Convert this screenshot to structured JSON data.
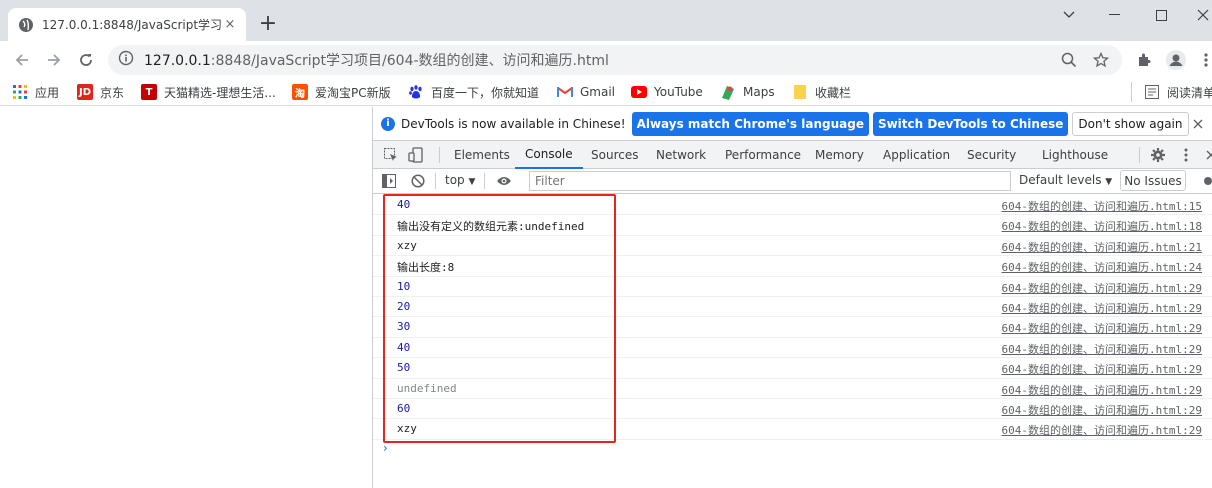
{
  "tab": {
    "title": "127.0.0.1:8848/JavaScript学习项",
    "close": "×",
    "newtab": "+"
  },
  "omnibox": {
    "host": "127.0.0.1",
    "path": ":8848/JavaScript学习项目/604-数组的创建、访问和遍历.html"
  },
  "bookmarks": [
    {
      "label": "应用",
      "icon": "apps-icon"
    },
    {
      "label": "京东",
      "icon": "jd-icon",
      "icon_text": "JD",
      "color": "#e1251b"
    },
    {
      "label": "天猫精选-理想生活...",
      "icon": "tmall-icon",
      "icon_text": "T",
      "color": "#c40000"
    },
    {
      "label": "爱淘宝PC新版",
      "icon": "taobao-icon",
      "icon_text": "淘",
      "color": "#ff5000"
    },
    {
      "label": "百度一下，你就知道",
      "icon": "baidu-icon",
      "color": "#2932e1"
    },
    {
      "label": "Gmail",
      "icon": "gmail-icon",
      "color": "#ea4335"
    },
    {
      "label": "YouTube",
      "icon": "youtube-icon",
      "color": "#ff0000"
    },
    {
      "label": "Maps",
      "icon": "maps-icon",
      "color": "#34a853"
    },
    {
      "label": "收藏栏",
      "icon": "folder-icon",
      "color": "#f9d24e"
    },
    {
      "label": "阅读清单",
      "icon": "reading-list-icon"
    }
  ],
  "infobar": {
    "message": "DevTools is now available in Chinese!",
    "btn_match": "Always match Chrome's language",
    "btn_switch": "Switch DevTools to Chinese",
    "btn_dismiss": "Don't show again"
  },
  "devtools_tabs": [
    "Elements",
    "Console",
    "Sources",
    "Network",
    "Performance",
    "Memory",
    "Application",
    "Security",
    "Lighthouse"
  ],
  "active_tab": "Console",
  "console_bar": {
    "context": "top",
    "filter_placeholder": "Filter",
    "levels": "Default levels",
    "issues": "No Issues"
  },
  "console_rows": [
    {
      "msg": "40",
      "type": "num",
      "src": "604-数组的创建、访问和遍历.html:15"
    },
    {
      "msg": "输出没有定义的数组元素:undefined",
      "type": "text",
      "src": "604-数组的创建、访问和遍历.html:18"
    },
    {
      "msg": "xzy",
      "type": "text",
      "src": "604-数组的创建、访问和遍历.html:21"
    },
    {
      "msg": "输出长度:8",
      "type": "text",
      "src": "604-数组的创建、访问和遍历.html:24"
    },
    {
      "msg": "10",
      "type": "num",
      "src": "604-数组的创建、访问和遍历.html:29"
    },
    {
      "msg": "20",
      "type": "num",
      "src": "604-数组的创建、访问和遍历.html:29"
    },
    {
      "msg": "30",
      "type": "num",
      "src": "604-数组的创建、访问和遍历.html:29"
    },
    {
      "msg": "40",
      "type": "num",
      "src": "604-数组的创建、访问和遍历.html:29"
    },
    {
      "msg": "50",
      "type": "num",
      "src": "604-数组的创建、访问和遍历.html:29"
    },
    {
      "msg": "undefined",
      "type": "undef",
      "src": "604-数组的创建、访问和遍历.html:29"
    },
    {
      "msg": "60",
      "type": "num",
      "src": "604-数组的创建、访问和遍历.html:29"
    },
    {
      "msg": "xzy",
      "type": "text",
      "src": "604-数组的创建、访问和遍历.html:29"
    }
  ],
  "prompt": "›",
  "colors": {
    "highlight_box": "#e5261e",
    "accent": "#1a73e8"
  }
}
